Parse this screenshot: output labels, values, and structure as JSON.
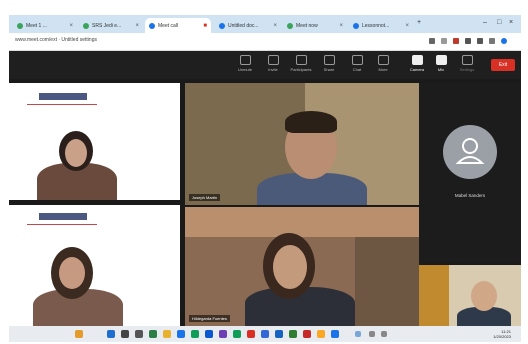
{
  "browser": {
    "tabs": [
      {
        "label": "Meet 1 ..."
      },
      {
        "label": "SRS Jedi e..."
      },
      {
        "label": "Meet call"
      },
      {
        "label": "Untitled doc..."
      },
      {
        "label": "Meet now"
      },
      {
        "label": "Lessonnot..."
      }
    ],
    "url": "www.meet.com/ext · Untitled settings"
  },
  "toolbar": {
    "buttons": [
      {
        "label": "Unmute"
      },
      {
        "label": "Invite"
      },
      {
        "label": "Participants"
      },
      {
        "label": "Share"
      },
      {
        "label": "Chat"
      },
      {
        "label": "More"
      },
      {
        "label": "Camera"
      },
      {
        "label": "Mic"
      },
      {
        "label": "Settings"
      }
    ],
    "leave_label": "Exit"
  },
  "tiles": {
    "presenter_name": "Joseph Martin",
    "woman_name": "Hildegarda Fuentes"
  },
  "avatar": {
    "name": "Mabel Sanders"
  },
  "clock": {
    "time": "11:21",
    "date": "1/20/2023"
  },
  "colors": {
    "leave": "#d93025",
    "tabbar": "#cfe3f3",
    "meeting_bg": "#1f1f1f"
  }
}
